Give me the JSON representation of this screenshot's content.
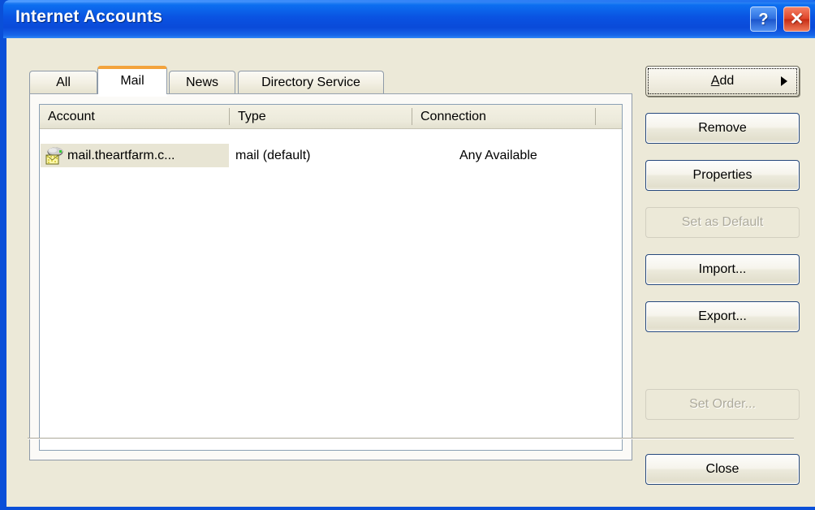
{
  "window": {
    "title": "Internet Accounts",
    "titlebar_buttons": [
      {
        "name": "help",
        "glyph": "?"
      },
      {
        "name": "close",
        "glyph": "✕"
      }
    ],
    "colors": {
      "titlebar_blue": "#0a4fd8",
      "dialog_face": "#ece9d8",
      "active_tab_accent": "#f3a33c",
      "close_red": "#e0452a"
    }
  },
  "tabs": [
    {
      "label": "All",
      "active": false
    },
    {
      "label": "Mail",
      "active": true
    },
    {
      "label": "News",
      "active": false
    },
    {
      "label": "Directory Service",
      "active": false
    }
  ],
  "list": {
    "columns": [
      {
        "label": "Account"
      },
      {
        "label": "Type"
      },
      {
        "label": "Connection"
      },
      {
        "label": ""
      }
    ],
    "rows": [
      {
        "icon": "mail-server-icon",
        "account": "mail.theartfarm.c...",
        "type": "mail (default)",
        "connection": "Any Available",
        "extra": "",
        "selected": true
      }
    ]
  },
  "buttons": {
    "add": {
      "label": "Add",
      "accel": "A",
      "has_menu_arrow": true,
      "enabled": true,
      "focused": true
    },
    "remove": {
      "label": "Remove",
      "enabled": true
    },
    "properties": {
      "label": "Properties",
      "enabled": true
    },
    "set_as_default": {
      "label": "Set as Default",
      "enabled": false
    },
    "import": {
      "label": "Import...",
      "enabled": true
    },
    "export": {
      "label": "Export...",
      "enabled": true
    },
    "set_order": {
      "label": "Set Order...",
      "enabled": false
    },
    "close": {
      "label": "Close",
      "enabled": true
    }
  }
}
